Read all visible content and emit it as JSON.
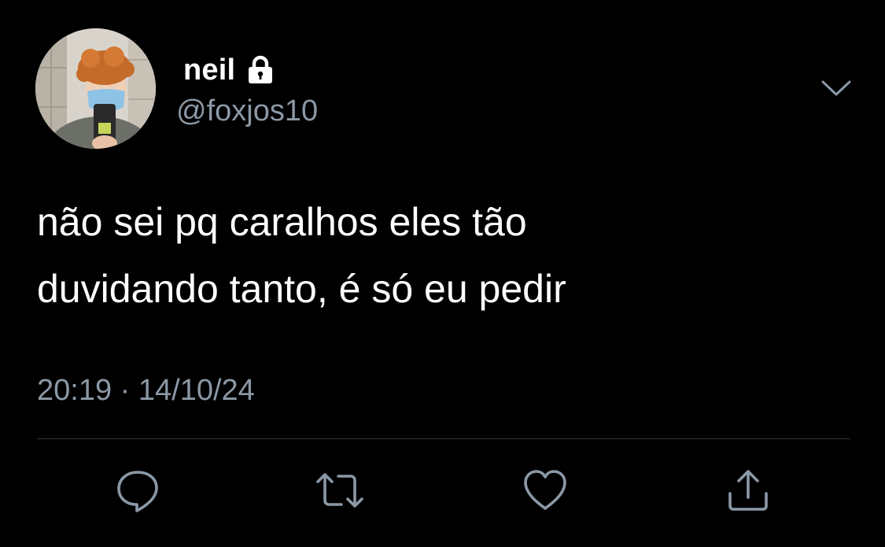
{
  "tweet": {
    "display_name": "neil",
    "handle": "@foxjos10",
    "text_lines": [
      "não sei pq caralhos eles tão",
      "duvidando tanto, é só eu pedir"
    ],
    "time": "20:19",
    "separator": "·",
    "date": "14/10/24"
  },
  "icons": {
    "lock": "lock-icon",
    "menu": "chevron-down-icon",
    "reply": "reply-icon",
    "retweet": "retweet-icon",
    "like": "heart-icon",
    "share": "share-icon"
  },
  "colors": {
    "background": "#000000",
    "text": "#ffffff",
    "secondary_text": "#8b98a5",
    "icon": "#8b98a5",
    "divider": "#2f3336"
  }
}
